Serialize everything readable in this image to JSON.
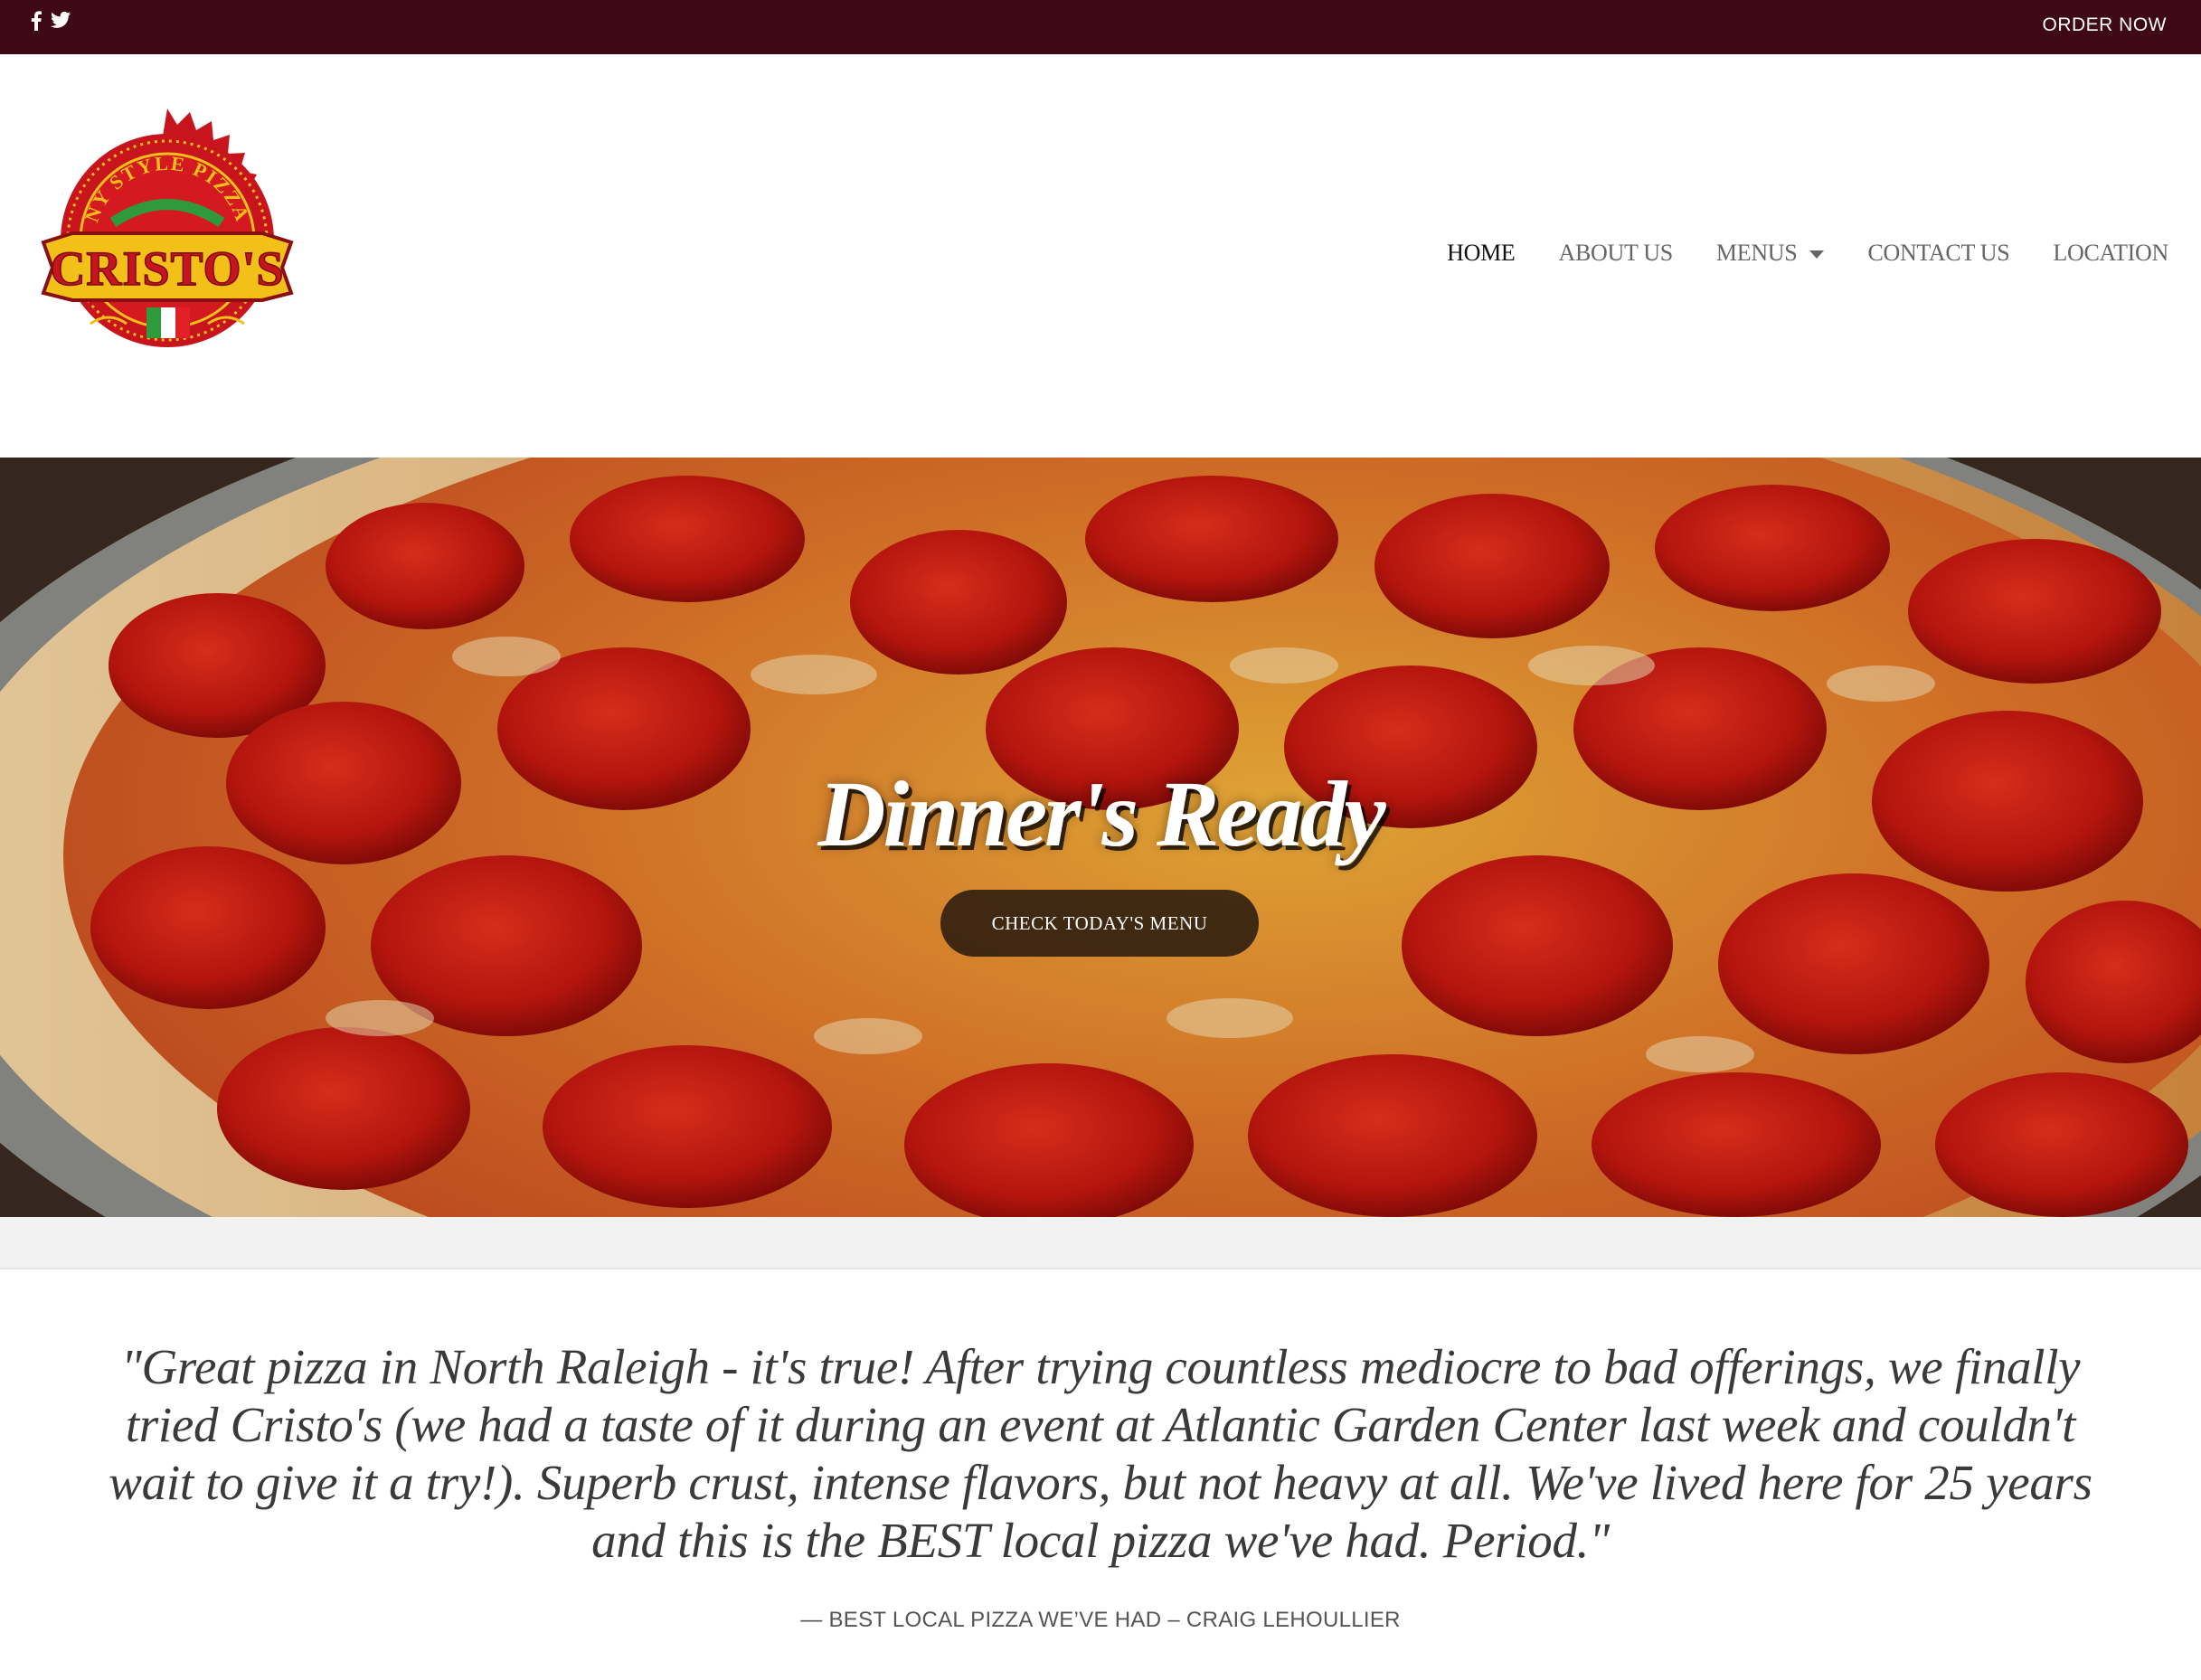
{
  "topbar": {
    "social": [
      {
        "icon": "facebook-icon",
        "glyph": "f"
      },
      {
        "icon": "twitter-icon",
        "glyph": "t"
      }
    ],
    "order_now": "ORDER NOW",
    "background": "#3e0816"
  },
  "header": {
    "logo": {
      "brand": "CRISTO'S",
      "tagline": "NY STYLE PIZZA"
    },
    "nav": [
      {
        "label": "HOME",
        "active": true
      },
      {
        "label": "ABOUT US"
      },
      {
        "label": "MENUS",
        "has_dropdown": true
      },
      {
        "label": "CONTACT US"
      },
      {
        "label": "LOCATION"
      }
    ]
  },
  "hero": {
    "title": "Dinner's Ready",
    "button": "CHECK TODAY'S MENU"
  },
  "testimonial": {
    "quote": "\"Great pizza in North Raleigh - it's true! After trying countless mediocre to bad offerings, we finally tried Cristo's (we had a taste of it during an event at Atlantic Garden Center last week and couldn't wait to give it a try!). Superb crust, intense flavors, but not heavy at all. We've lived here for 25 years and this is the BEST local pizza we've had. Period.\"",
    "cite": "— BEST LOCAL PIZZA WE’VE HAD – CRAIG LEHOULLIER"
  },
  "colors": {
    "accent": "#3e0816",
    "logo_red": "#c8141c",
    "logo_gold": "#f3c01a",
    "italian_green": "#2e9a3a"
  }
}
